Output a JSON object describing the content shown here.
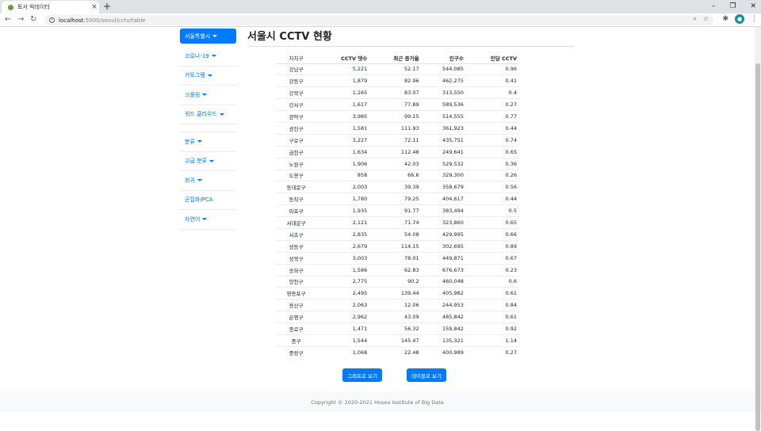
{
  "browser": {
    "tab_title": "토서 빅데이터",
    "tab_close": "×",
    "new_tab": "+",
    "url_host": "localhost",
    "url_path": ":5000/seoul/cctv/table",
    "controls": {
      "minimize": "–",
      "restore": "❐",
      "close": "✕"
    },
    "nav": {
      "back": "←",
      "forward": "→",
      "reload": "↻"
    },
    "zoom_icon": "⌕",
    "star_icon": "☆",
    "extension_icon": "✱",
    "menu_icon": "⋮",
    "avatar_letter": "●"
  },
  "sidebar": {
    "items": [
      {
        "label": "서울특별시",
        "caret": true,
        "active": true
      },
      {
        "label": "코로나-19",
        "caret": true
      },
      {
        "label": "카토그램",
        "caret": true
      },
      {
        "label": "크롤링",
        "caret": true
      },
      {
        "label": "워드 클라우드",
        "caret": true
      },
      {
        "gap": true
      },
      {
        "label": "분류",
        "caret": true
      },
      {
        "label": "고급 분류",
        "caret": true
      },
      {
        "label": "회귀",
        "caret": true
      },
      {
        "label": "군집화/PCA",
        "caret": false
      },
      {
        "label": "자연어",
        "caret": true
      }
    ]
  },
  "main": {
    "title": "서울시 CCTV 현황",
    "table": {
      "columns": [
        "자치구",
        "CCTV 댓수",
        "최근 증가율",
        "인구수",
        "인당 CCTV"
      ],
      "rows": [
        [
          "강남구",
          "5,221",
          "52.17",
          "544,085",
          "0.96"
        ],
        [
          "강동구",
          "1,879",
          "82.96",
          "462,275",
          "0.41"
        ],
        [
          "강북구",
          "1,265",
          "83.07",
          "313,550",
          "0.4"
        ],
        [
          "강서구",
          "1,617",
          "77.89",
          "589,536",
          "0.27"
        ],
        [
          "관악구",
          "3,985",
          "99.15",
          "514,555",
          "0.77"
        ],
        [
          "광진구",
          "1,581",
          "111.93",
          "361,923",
          "0.44"
        ],
        [
          "구로구",
          "3,227",
          "72.11",
          "435,751",
          "0.74"
        ],
        [
          "금천구",
          "1,634",
          "112.48",
          "249,641",
          "0.65"
        ],
        [
          "노원구",
          "1,906",
          "42.03",
          "529,532",
          "0.36"
        ],
        [
          "도봉구",
          "858",
          "66.6",
          "329,300",
          "0.26"
        ],
        [
          "동대문구",
          "2,003",
          "39.39",
          "358,679",
          "0.56"
        ],
        [
          "동작구",
          "1,780",
          "79.25",
          "404,617",
          "0.44"
        ],
        [
          "마포구",
          "1,935",
          "91.77",
          "383,494",
          "0.5"
        ],
        [
          "서대문구",
          "2,121",
          "71.74",
          "323,860",
          "0.65"
        ],
        [
          "서초구",
          "2,835",
          "54.08",
          "429,995",
          "0.66"
        ],
        [
          "성동구",
          "2,679",
          "114.15",
          "302,695",
          "0.89"
        ],
        [
          "성북구",
          "3,003",
          "78.01",
          "449,871",
          "0.67"
        ],
        [
          "송파구",
          "1,586",
          "62.83",
          "676,673",
          "0.23"
        ],
        [
          "양천구",
          "2,775",
          "90.2",
          "460,048",
          "0.6"
        ],
        [
          "영등포구",
          "2,495",
          "139.44",
          "405,982",
          "0.61"
        ],
        [
          "용산구",
          "2,063",
          "12.06",
          "244,953",
          "0.84"
        ],
        [
          "은평구",
          "2,962",
          "43.09",
          "485,842",
          "0.61"
        ],
        [
          "종로구",
          "1,471",
          "56.32",
          "159,842",
          "0.92"
        ],
        [
          "중구",
          "1,544",
          "145.47",
          "135,321",
          "1.14"
        ],
        [
          "중랑구",
          "1,068",
          "22.48",
          "400,989",
          "0.27"
        ]
      ]
    },
    "buttons": {
      "graph": "그래프로 보기",
      "table": "테이블로 보기"
    }
  },
  "footer": {
    "text": "Copyright © 2020-2021 Hoseo Institute of Big Data"
  },
  "colors": {
    "accent": "#007bff",
    "text": "#212529",
    "footer_bg": "#f8f9fa"
  }
}
